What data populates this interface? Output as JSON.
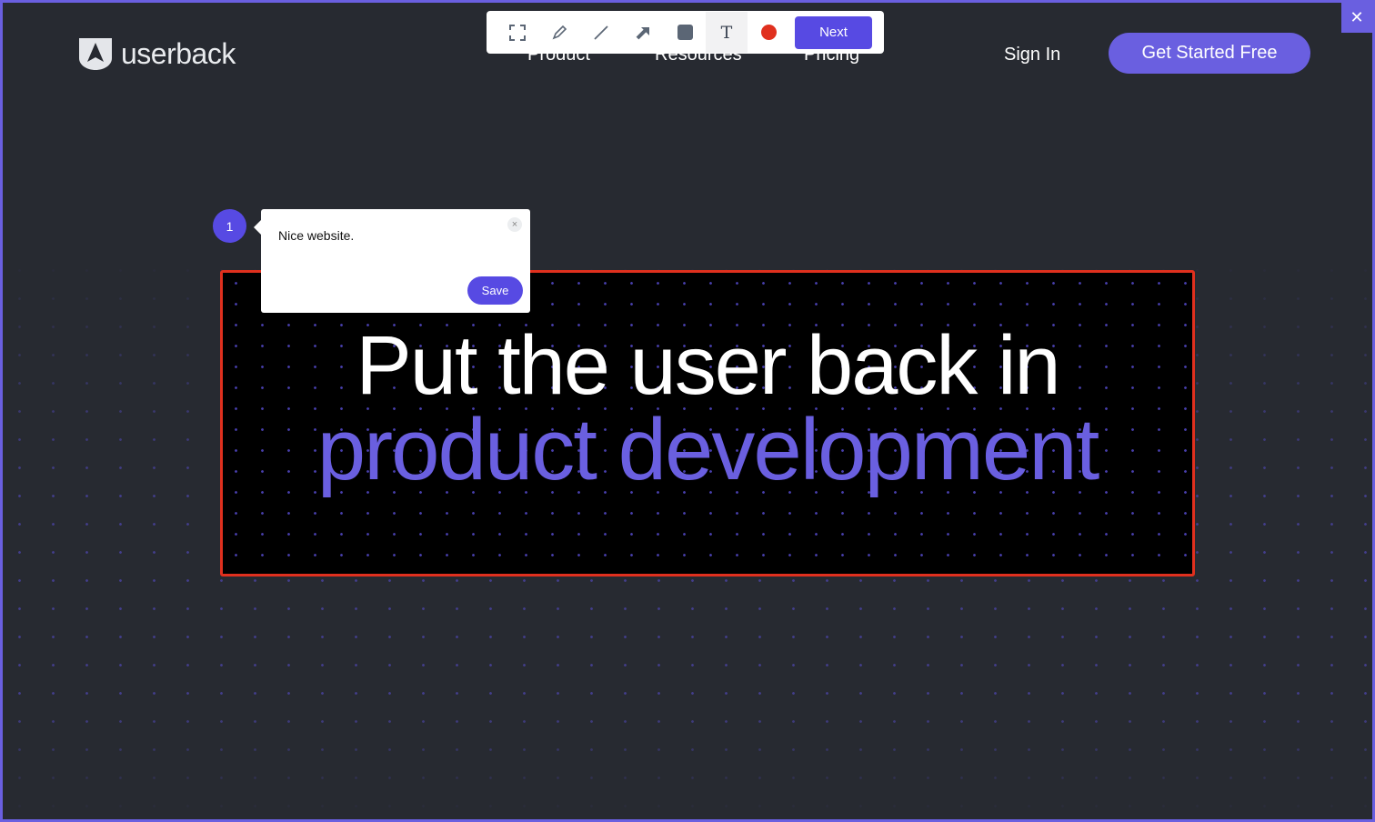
{
  "brand": {
    "name": "userback"
  },
  "nav": {
    "items": [
      "Product",
      "Resources",
      "Pricing"
    ],
    "sign_in": "Sign In",
    "cta": "Get Started Free"
  },
  "hero": {
    "line1": "Put the user back in",
    "line2": "product development"
  },
  "toolbar": {
    "tools": [
      "crop-icon",
      "highlighter-icon",
      "line-icon",
      "arrow-icon",
      "rectangle-icon",
      "text-icon",
      "color-red-icon"
    ],
    "next_label": "Next",
    "active_color": "#e0301e"
  },
  "comment": {
    "number": "1",
    "text": "Nice website.",
    "save_label": "Save",
    "close": "×"
  },
  "window": {
    "close": "✕"
  }
}
